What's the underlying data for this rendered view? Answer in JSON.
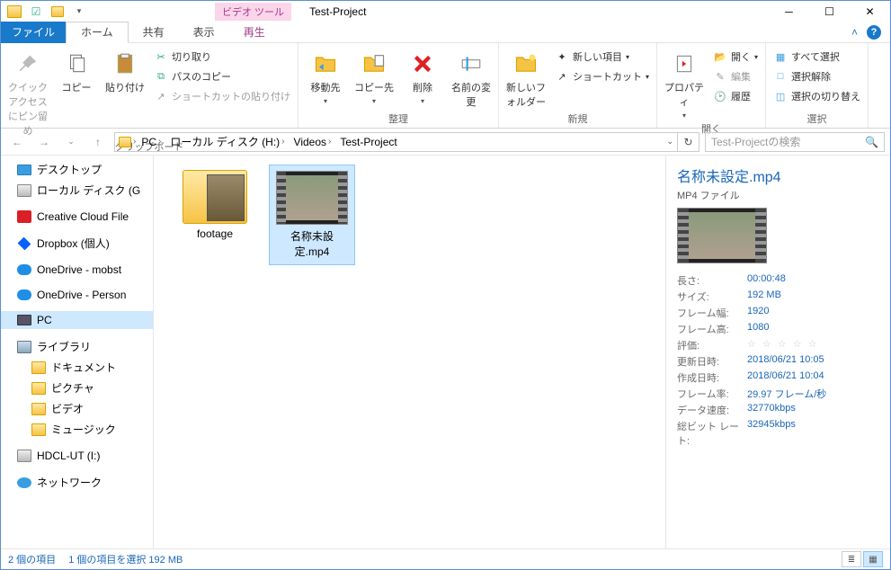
{
  "window": {
    "title": "Test-Project",
    "context_tab": "ビデオ ツール"
  },
  "tabs": {
    "file": "ファイル",
    "home": "ホーム",
    "share": "共有",
    "view": "表示",
    "play": "再生"
  },
  "ribbon": {
    "clipboard": {
      "pin": "クイック アクセスにピン留め",
      "copy": "コピー",
      "paste": "貼り付け",
      "cut": "切り取り",
      "copy_path": "パスのコピー",
      "paste_shortcut": "ショートカットの貼り付け",
      "group": "クリップボード"
    },
    "organize": {
      "move": "移動先",
      "copy_to": "コピー先",
      "delete": "削除",
      "rename": "名前の変更",
      "group": "整理"
    },
    "new": {
      "new_folder": "新しいフォルダー",
      "new_item": "新しい項目",
      "shortcut": "ショートカット",
      "group": "新規"
    },
    "open": {
      "properties": "プロパティ",
      "open": "開く",
      "edit": "編集",
      "history": "履歴",
      "group": "開く"
    },
    "select": {
      "all": "すべて選択",
      "none": "選択解除",
      "invert": "選択の切り替え",
      "group": "選択"
    }
  },
  "breadcrumb": {
    "segs": [
      "PC",
      "ローカル ディスク (H:)",
      "Videos",
      "Test-Project"
    ]
  },
  "search": {
    "placeholder": "Test-Projectの検索"
  },
  "nav": {
    "desktop": "デスクトップ",
    "local_g": "ローカル ディスク (G",
    "cc": "Creative Cloud File",
    "dropbox": "Dropbox (個人)",
    "od1": "OneDrive - mobst",
    "od2": "OneDrive - Person",
    "pc": "PC",
    "library": "ライブラリ",
    "docs": "ドキュメント",
    "pics": "ピクチャ",
    "video": "ビデオ",
    "music": "ミュージック",
    "hdcl": "HDCL-UT (I:)",
    "network": "ネットワーク"
  },
  "items": {
    "folder": "footage",
    "video": "名称未設定.mp4"
  },
  "details": {
    "name": "名称未設定.mp4",
    "type": "MP4 ファイル",
    "rows": [
      {
        "k": "長さ:",
        "v": "00:00:48"
      },
      {
        "k": "サイズ:",
        "v": "192 MB"
      },
      {
        "k": "フレーム幅:",
        "v": "1920"
      },
      {
        "k": "フレーム高:",
        "v": "1080"
      },
      {
        "k": "評価:",
        "v": "☆ ☆ ☆ ☆ ☆",
        "stars": true
      },
      {
        "k": "更新日時:",
        "v": "2018/06/21 10:05"
      },
      {
        "k": "作成日時:",
        "v": "2018/06/21 10:04"
      },
      {
        "k": "フレーム率:",
        "v": "29.97 フレーム/秒"
      },
      {
        "k": "データ速度:",
        "v": "32770kbps"
      },
      {
        "k": "総ビット レート:",
        "v": "32945kbps"
      }
    ]
  },
  "status": {
    "count": "2 個の項目",
    "selected": "1 個の項目を選択 192 MB"
  }
}
